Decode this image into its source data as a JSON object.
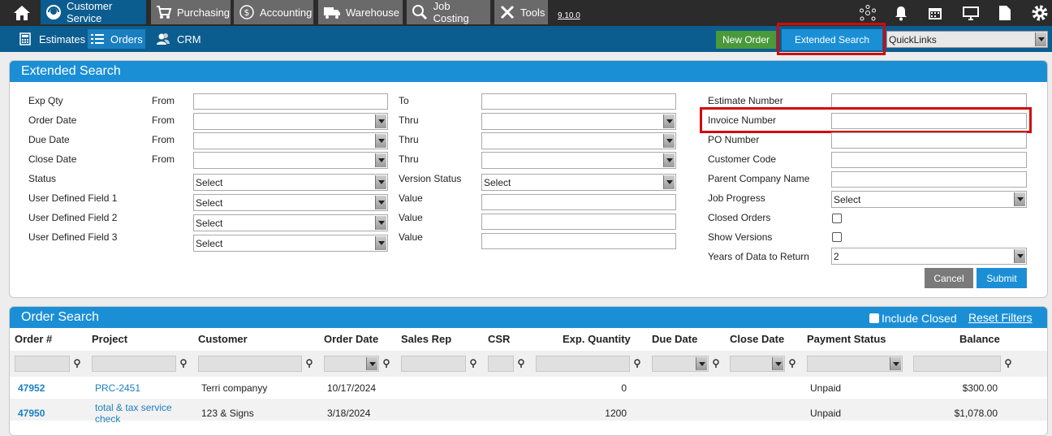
{
  "topnav": {
    "tabs": [
      {
        "label": "Customer Service",
        "icon": "headset-icon"
      },
      {
        "label": "Purchasing",
        "icon": "cart-icon"
      },
      {
        "label": "Accounting",
        "icon": "dollar-icon"
      },
      {
        "label": "Warehouse",
        "icon": "truck-icon"
      },
      {
        "label": "Job Costing",
        "icon": "search-icon"
      },
      {
        "label": "Tools",
        "icon": "tools-icon"
      }
    ],
    "version": "9.10.0"
  },
  "subnav": {
    "items": [
      {
        "label": "Estimates",
        "icon": "calculator-icon"
      },
      {
        "label": "Orders",
        "icon": "list-icon"
      },
      {
        "label": "CRM",
        "icon": "users-icon"
      }
    ],
    "new_order": "New Order",
    "extended_search": "Extended Search",
    "quicklinks": "QuickLinks"
  },
  "extended_search": {
    "title": "Extended Search",
    "rows": [
      {
        "label": "Exp Qty",
        "from": "From",
        "to": "To"
      },
      {
        "label": "Order Date",
        "from": "From",
        "to": "Thru"
      },
      {
        "label": "Due Date",
        "from": "From",
        "to": "Thru"
      },
      {
        "label": "Close Date",
        "from": "From",
        "to": "Thru"
      },
      {
        "label": "Status",
        "select": "Select",
        "mid_label": "Version Status",
        "mid_select": "Select"
      },
      {
        "label": "User Defined Field 1",
        "select": "Select",
        "mid_label": "Value"
      },
      {
        "label": "User Defined Field 2",
        "select": "Select",
        "mid_label": "Value"
      },
      {
        "label": "User Defined Field 3",
        "select": "Select",
        "mid_label": "Value"
      }
    ],
    "right": {
      "estimate_number": "Estimate Number",
      "invoice_number": "Invoice Number",
      "po_number": "PO Number",
      "customer_code": "Customer Code",
      "parent_company_name": "Parent Company Name",
      "job_progress": "Job Progress",
      "job_progress_value": "Select",
      "closed_orders": "Closed Orders",
      "show_versions": "Show Versions",
      "years_of_data": "Years of Data to Return",
      "years_value": "2"
    },
    "cancel": "Cancel",
    "submit": "Submit"
  },
  "order_search": {
    "title": "Order Search",
    "include_closed": "Include Closed",
    "reset_filters": "Reset Filters",
    "columns": [
      "Order #",
      "Project",
      "Customer",
      "Order Date",
      "Sales Rep",
      "CSR",
      "Exp. Quantity",
      "Due Date",
      "Close Date",
      "Payment Status",
      "Balance"
    ],
    "rows": [
      {
        "order": "47952",
        "project": "PRC-2451",
        "customer": "Terri companyy",
        "order_date": "10/17/2024",
        "exp_qty": "0",
        "payment_status": "Unpaid",
        "balance": "$300.00"
      },
      {
        "order": "47950",
        "project": "total & tax service check",
        "project_line1": "total & tax service",
        "project_line2": "check",
        "customer": "123 & Signs",
        "order_date": "3/18/2024",
        "exp_qty": "1200",
        "payment_status": "Unpaid",
        "balance": "$1,078.00"
      }
    ]
  }
}
